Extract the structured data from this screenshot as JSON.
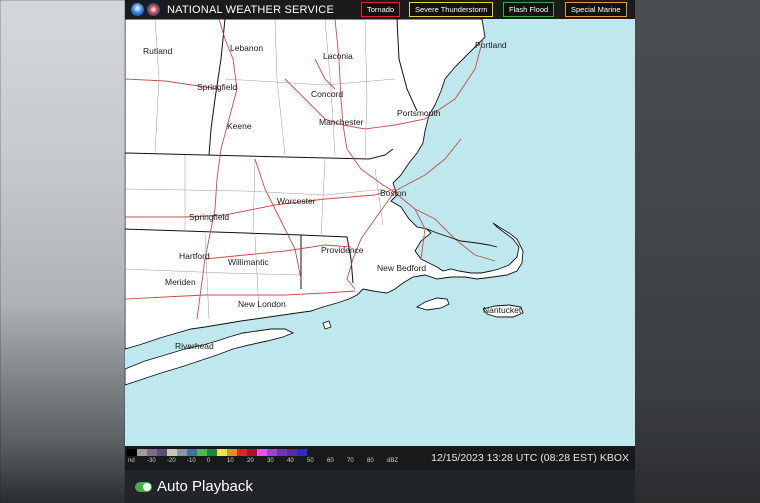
{
  "header": {
    "agency": "NATIONAL WEATHER SERVICE",
    "warnings": [
      {
        "label": "Tornado",
        "color": "#e0242b"
      },
      {
        "label": "Severe Thunderstorm",
        "color": "#e8d23a"
      },
      {
        "label": "Flash Flood",
        "color": "#3ca84a"
      },
      {
        "label": "Special Marine",
        "color": "#e89a3a"
      }
    ]
  },
  "map": {
    "water_color": "#bfe8ee",
    "land_color": "#ffffff",
    "road_color": "#c0504d",
    "cities": [
      "Rutland",
      "Lebanon",
      "Laconia",
      "Portland",
      "Springfield",
      "Concord",
      "Keene",
      "Manchester",
      "Portsmouth",
      "Worcester",
      "Boston",
      "Springfield",
      "Providence",
      "Hartford",
      "Willimantic",
      "New Bedford",
      "Meriden",
      "New London",
      "Nantucket",
      "Riverhead"
    ]
  },
  "colorbar": {
    "labels": [
      "nd",
      "-30",
      "-20",
      "-10",
      "0",
      "10",
      "20",
      "30",
      "40",
      "50",
      "60",
      "70",
      "80",
      "dBZ"
    ],
    "colors": [
      "#000000",
      "#9c9c9c",
      "#7a6b8c",
      "#5b4f7a",
      "#c8c8b4",
      "#8a96a8",
      "#3d6fa8",
      "#4fb84a",
      "#1f8a2a",
      "#f2e14a",
      "#e8901e",
      "#e02424",
      "#a8122a",
      "#f050f0",
      "#9b44d6",
      "#7034b0",
      "#5a2aa0",
      "#2c2cc8"
    ]
  },
  "timestamp": "12/15/2023 13:28 UTC (08:28 EST) KBOX",
  "playback": {
    "label": "Auto Playback",
    "enabled": true
  }
}
